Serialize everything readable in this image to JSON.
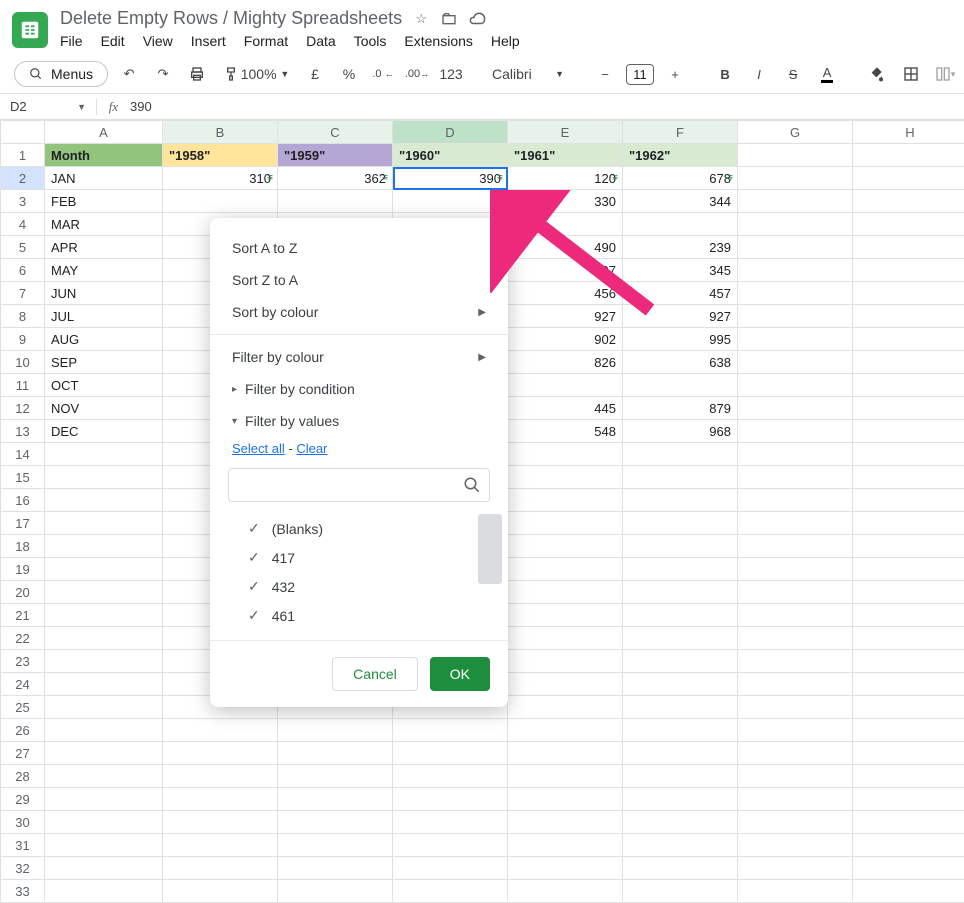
{
  "doc": {
    "title": "Delete Empty Rows / Mighty Spreadsheets"
  },
  "menubar": [
    "File",
    "Edit",
    "View",
    "Insert",
    "Format",
    "Data",
    "Tools",
    "Extensions",
    "Help"
  ],
  "toolbar": {
    "menus_label": "Menus",
    "zoom": "100%",
    "currency": "£",
    "percent": "%",
    "dec_dec": ".0",
    "inc_dec": ".00",
    "num_fmt": "123",
    "font": "Calibri",
    "font_size": "11"
  },
  "formula": {
    "cell_ref": "D2",
    "fx": "fx",
    "value": "390"
  },
  "columns": [
    "A",
    "B",
    "C",
    "D",
    "E",
    "F",
    "G",
    "H"
  ],
  "row_numbers": [
    1,
    2,
    3,
    4,
    5,
    6,
    7,
    8,
    9,
    10,
    11,
    12,
    13,
    14,
    15,
    16,
    17,
    18,
    19,
    20,
    21,
    22,
    23,
    24,
    25,
    26,
    27,
    28,
    29,
    30,
    31,
    32,
    33
  ],
  "header_row": {
    "month": "Month",
    "y1958": "\"1958\"",
    "y1959": "\"1959\"",
    "y1960": "\"1960\"",
    "y1961": "\"1961\"",
    "y1962": "\"1962\""
  },
  "months": [
    "JAN",
    "FEB",
    "MAR",
    "APR",
    "MAY",
    "JUN",
    "JUL",
    "AUG",
    "SEP",
    "OCT",
    "NOV",
    "DEC"
  ],
  "data_row2": {
    "b": "310",
    "c": "362",
    "d": "390",
    "e": "120",
    "f": "678"
  },
  "col_e_vals": {
    "r3": "330",
    "r5": "490",
    "r6": "607",
    "r7": "456",
    "r8": "927",
    "r9": "902",
    "r10": "826",
    "r12": "445",
    "r13": "548"
  },
  "col_f_vals": {
    "r3": "344",
    "r5": "239",
    "r6": "345",
    "r7": "457",
    "r8": "927",
    "r9": "995",
    "r10": "638",
    "r12": "879",
    "r13": "968"
  },
  "popup": {
    "sort_az": "Sort A to Z",
    "sort_za": "Sort Z to A",
    "sort_colour": "Sort by colour",
    "filter_colour": "Filter by colour",
    "filter_condition": "Filter by condition",
    "filter_values": "Filter by values",
    "select_all": "Select all",
    "dash": " - ",
    "clear": "Clear",
    "search_placeholder": "",
    "values": [
      "(Blanks)",
      "417",
      "432",
      "461"
    ],
    "cancel": "Cancel",
    "ok": "OK"
  }
}
